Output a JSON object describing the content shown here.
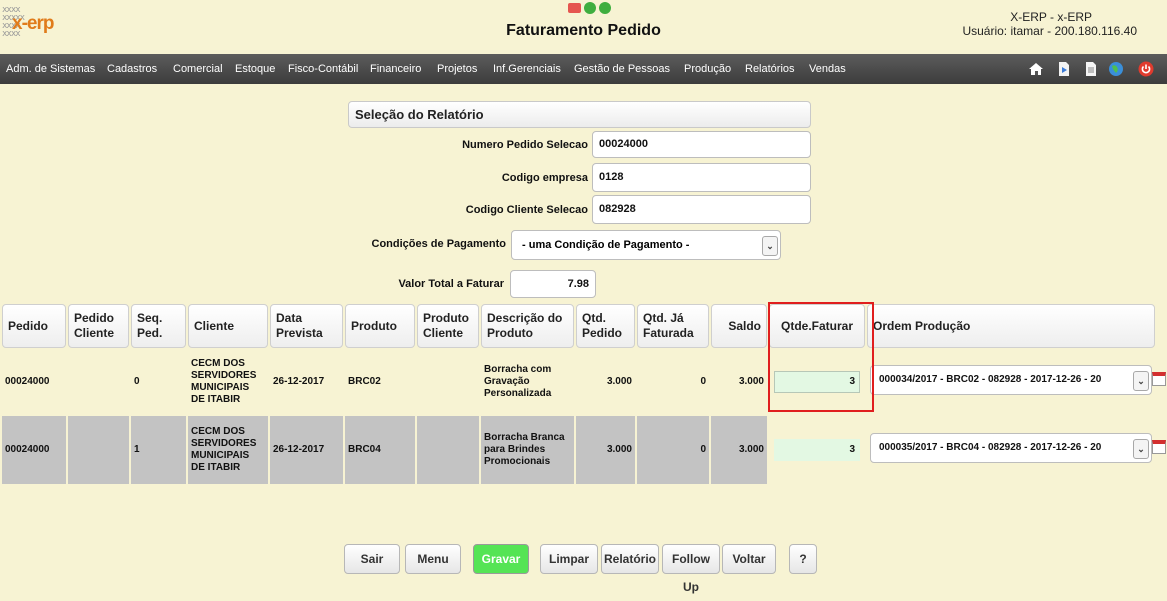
{
  "header": {
    "logo_text": "x-erp",
    "logo_pattern": "xxxx\nxxxxx\nxxxx\nxxxx",
    "title": "Faturamento Pedido",
    "system_name": "X-ERP - x-ERP",
    "user_info": "Usuário: itamar - 200.180.116.40"
  },
  "menu": {
    "items": [
      "Adm. de Sistemas",
      "Cadastros",
      "Comercial",
      "Estoque",
      "Fisco-Contábil",
      "Financeiro",
      "Projetos",
      "Inf.Gerenciais",
      "Gestão de Pessoas",
      "Produção",
      "Relatórios",
      "Vendas"
    ],
    "icons": [
      "home-icon",
      "document-arrow-icon",
      "page-icon",
      "globe-icon",
      "power-icon"
    ]
  },
  "form": {
    "section_title": "Seleção do Relatório",
    "numero_pedido_label": "Numero Pedido Selecao",
    "numero_pedido_value": "00024000",
    "codigo_empresa_label": "Codigo empresa",
    "codigo_empresa_value": "0128",
    "codigo_cliente_label": "Codigo Cliente Selecao",
    "codigo_cliente_value": "082928",
    "condicoes_label": "Condições de Pagamento",
    "condicoes_value": "- uma Condição de Pagamento -",
    "valor_total_label": "Valor Total a Faturar",
    "valor_total_value": "7.98"
  },
  "table": {
    "headers": [
      "Pedido",
      "Pedido Cliente",
      "Seq. Ped.",
      "Cliente",
      "Data Prevista",
      "Produto",
      "Produto Cliente",
      "Descrição do Produto",
      "Qtd. Pedido",
      "Qtd. Já Faturada",
      "Saldo",
      "Qtde.Faturar",
      "Ordem Produção"
    ],
    "rows": [
      {
        "pedido": "00024000",
        "pedido_cliente": "",
        "seq": "0",
        "cliente": "CECM DOS SERVIDORES MUNICIPAIS DE ITABIR",
        "data": "26-12-2017",
        "produto": "BRC02",
        "produto_cliente": "",
        "descricao": "Borracha com Gravação Personalizada",
        "qtd_pedido": "3.000",
        "qtd_faturada": "0",
        "saldo": "3.000",
        "qtde_faturar": "3",
        "ordem": "000034/2017 - BRC02 - 082928 - 2017-12-26 - 20"
      },
      {
        "pedido": "00024000",
        "pedido_cliente": "",
        "seq": "1",
        "cliente": "CECM DOS SERVIDORES MUNICIPAIS DE ITABIR",
        "data": "26-12-2017",
        "produto": "BRC04",
        "produto_cliente": "",
        "descricao": "Borracha Branca para Brindes Promocionais",
        "qtd_pedido": "3.000",
        "qtd_faturada": "0",
        "saldo": "3.000",
        "qtde_faturar": "3",
        "ordem": "000035/2017 - BRC04 - 082928 - 2017-12-26 - 20"
      }
    ]
  },
  "buttons": {
    "sair": "Sair",
    "menu": "Menu",
    "gravar": "Gravar",
    "limpar": "Limpar",
    "relatorio": "Relatório",
    "follow_up": "Follow Up",
    "voltar": "Voltar",
    "help": "?"
  },
  "colors": {
    "background": "#f7f3d3",
    "menubar": "#4a4a4a",
    "logo_accent": "#e07b1a",
    "gravar_button": "#55e455",
    "highlight_box": "#e01e1e",
    "qty_input": "#e3f8e3",
    "row_alt": "#c3c3c3"
  }
}
